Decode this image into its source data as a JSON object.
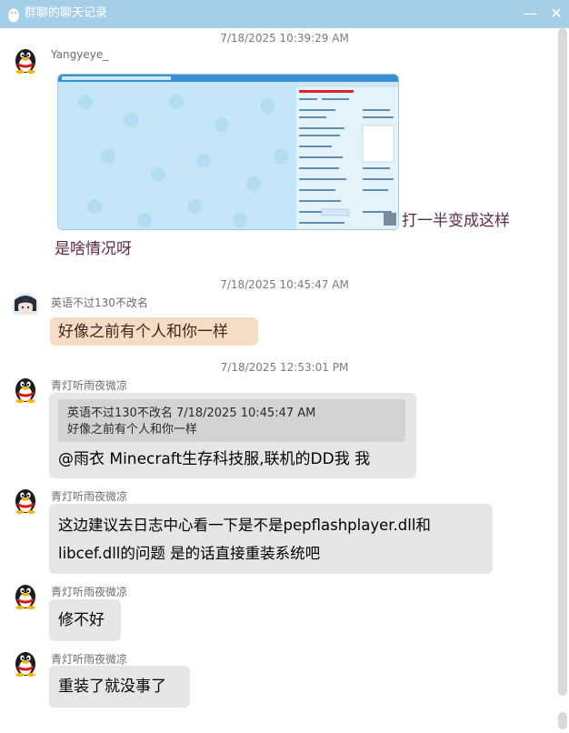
{
  "window": {
    "title": "群聊的聊天记录"
  },
  "controls": {
    "minimize": "—",
    "close": "✕"
  },
  "messages": [
    {
      "timestamp": "7/18/2025 10:39:29 AM",
      "sender": "Yangyeye_",
      "avatar": "qq-penguin-avatar",
      "image_caption": "打一半变成这样",
      "text": "是啥情况呀"
    },
    {
      "timestamp": "7/18/2025 10:45:47 AM",
      "sender": "英语不过130不改名",
      "avatar": "anime-girl-avatar",
      "text": "好像之前有个人和你一样"
    },
    {
      "timestamp": "7/18/2025 12:53:01 PM",
      "sender": "青灯听雨夜微凉",
      "avatar": "qq-penguin-avatar",
      "quote_header": "英语不过130不改名  7/18/2025 10:45:47 AM",
      "quote_text": "好像之前有个人和你一样",
      "text": "@雨衣 Minecraft生存科技服,联机的DD我 我"
    },
    {
      "sender": "青灯听雨夜微凉",
      "avatar": "qq-penguin-avatar",
      "text_line1": "这边建议去日志中心看一下是不是pepflashplayer.dll和",
      "text_line2": "libcef.dll的问题 是的话直接重装系统吧"
    },
    {
      "sender": "青灯听雨夜微凉",
      "avatar": "qq-penguin-avatar",
      "text": "修不好"
    },
    {
      "sender": "青灯听雨夜微凉",
      "avatar": "qq-penguin-avatar",
      "text": "重装了就没事了"
    }
  ],
  "colors": {
    "titlebar": "#a5cfe9",
    "bubble": "#e6e6e6",
    "highlight_bubble": "#f6dcc4",
    "plain_text": "#5c2b46"
  }
}
